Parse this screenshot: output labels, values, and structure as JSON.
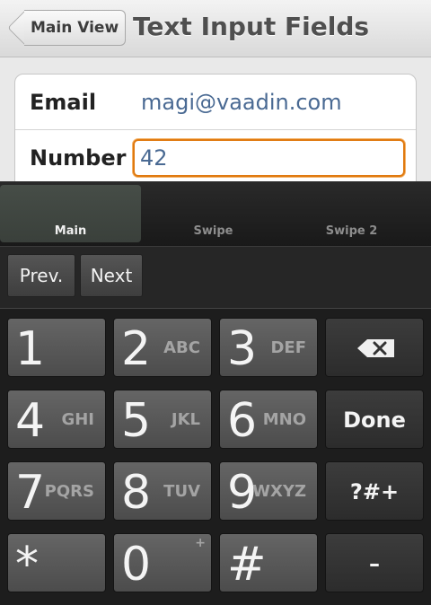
{
  "navbar": {
    "back_label": "Main View",
    "title": "Text Input Fields"
  },
  "form": {
    "email": {
      "label": "Email",
      "value": "magi@vaadin.com"
    },
    "number": {
      "label": "Number",
      "value": "42"
    }
  },
  "keyboard": {
    "tabs": [
      {
        "label": "Main",
        "active": true
      },
      {
        "label": "Swipe",
        "active": false
      },
      {
        "label": "Swipe 2",
        "active": false
      }
    ],
    "toolbar": {
      "prev_label": "Prev.",
      "next_label": "Next"
    },
    "keys": {
      "k1": {
        "main": "1",
        "letters": ""
      },
      "k2": {
        "main": "2",
        "letters": "ABC"
      },
      "k3": {
        "main": "3",
        "letters": "DEF"
      },
      "k4": {
        "main": "4",
        "letters": "GHI"
      },
      "k5": {
        "main": "5",
        "letters": "JKL"
      },
      "k6": {
        "main": "6",
        "letters": "MNO"
      },
      "k7": {
        "main": "7",
        "letters": "PQRS"
      },
      "k8": {
        "main": "8",
        "letters": "TUV"
      },
      "k9": {
        "main": "9",
        "letters": "WXYZ"
      },
      "star": {
        "main": "*"
      },
      "k0": {
        "main": "0",
        "alt": "+"
      },
      "hash": {
        "main": "#"
      },
      "done": "Done",
      "symbols": "?#+",
      "dash": "–",
      "backspace_icon": "backspace-icon"
    }
  },
  "colors": {
    "input_focus": "#e07a10",
    "value_text": "#4a6a93",
    "keyboard_bg": "#1d1d1d"
  }
}
